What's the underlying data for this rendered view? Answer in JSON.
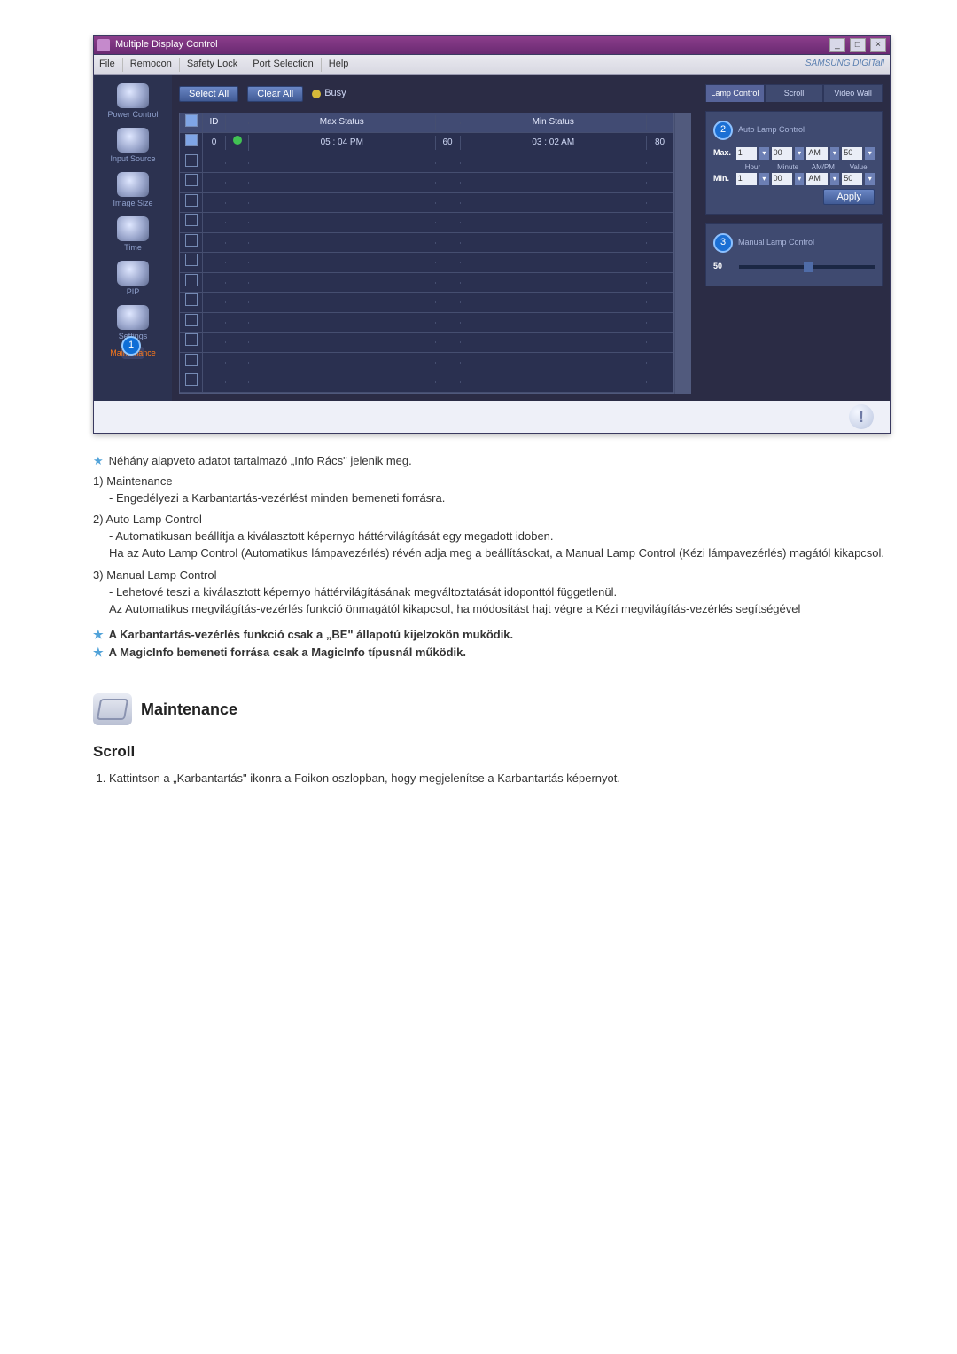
{
  "app": {
    "title": "Multiple Display Control",
    "menubar": [
      "File",
      "Remocon",
      "Safety Lock",
      "Port Selection",
      "Help"
    ],
    "brand": "SAMSUNG DIGITall",
    "sidebar": [
      {
        "label": "Power Control"
      },
      {
        "label": "Input Source"
      },
      {
        "label": "Image Size"
      },
      {
        "label": "Time"
      },
      {
        "label": "PIP"
      },
      {
        "label": "Settings"
      },
      {
        "label": "Maintenance",
        "selected": true,
        "badge": "1"
      }
    ],
    "buttons": {
      "selectAll": "Select All",
      "clearAll": "Clear All",
      "busy": "Busy"
    },
    "grid": {
      "headers": {
        "chk": "✓",
        "id": "ID",
        "status": "",
        "max": "Max Status",
        "maxVal": "",
        "min": "Min Status",
        "minVal": ""
      },
      "row": {
        "id": "0",
        "max": "05 : 04 PM",
        "maxVal": "60",
        "min": "03 : 02 AM",
        "minVal": "80"
      }
    },
    "right": {
      "tabs": [
        "Lamp Control",
        "Scroll",
        "Video Wall"
      ],
      "auto": {
        "title": "Auto Lamp Control",
        "badge": "2",
        "maxLabel": "Max.",
        "minLabel": "Min.",
        "cols": [
          "Hour",
          "Minute",
          "AM/PM",
          "Value"
        ],
        "max": {
          "hour": "1",
          "minute": "00",
          "ampm": "AM",
          "value": "50"
        },
        "min": {
          "hour": "1",
          "minute": "00",
          "ampm": "AM",
          "value": "50"
        },
        "apply": "Apply"
      },
      "manual": {
        "title": "Manual Lamp Control",
        "badge": "3",
        "value": "50"
      }
    }
  },
  "doc": {
    "intro": "Néhány alapveto adatot tartalmazó „Info Rács\" jelenik meg.",
    "items": [
      {
        "num": "1)",
        "title": "Maintenance",
        "lines": [
          "- Engedélyezi a Karbantartás-vezérlést minden bemeneti forrásra."
        ]
      },
      {
        "num": "2)",
        "title": "Auto Lamp Control",
        "lines": [
          "- Automatikusan beállítja a kiválasztott képernyo háttérvilágítását egy megadott idoben.\nHa az Auto Lamp Control (Automatikus lámpavezérlés) révén adja meg a beállításokat, a Manual Lamp Control (Kézi lámpavezérlés) magától kikapcsol."
        ]
      },
      {
        "num": "3)",
        "title": "Manual Lamp Control",
        "lines": [
          "- Lehetové teszi a kiválasztott képernyo háttérvilágításának megváltoztatását idoponttól függetlenül.\nAz Automatikus megvilágítás-vezérlés funkció önmagától kikapcsol, ha módosítást hajt végre a Kézi megvilágítás-vezérlés segítségével"
        ]
      }
    ],
    "bold1": "A Karbantartás-vezérlés funkció csak a „BE\" állapotú kijelzokön muködik.",
    "bold2": "A MagicInfo bemeneti forrása csak a MagicInfo típusnál működik.",
    "section": "Maintenance",
    "subsection": "Scroll",
    "step1": "Kattintson a „Karbantartás\" ikonra a Foikon oszlopban, hogy megjelenítse a Karbantartás képernyot."
  }
}
